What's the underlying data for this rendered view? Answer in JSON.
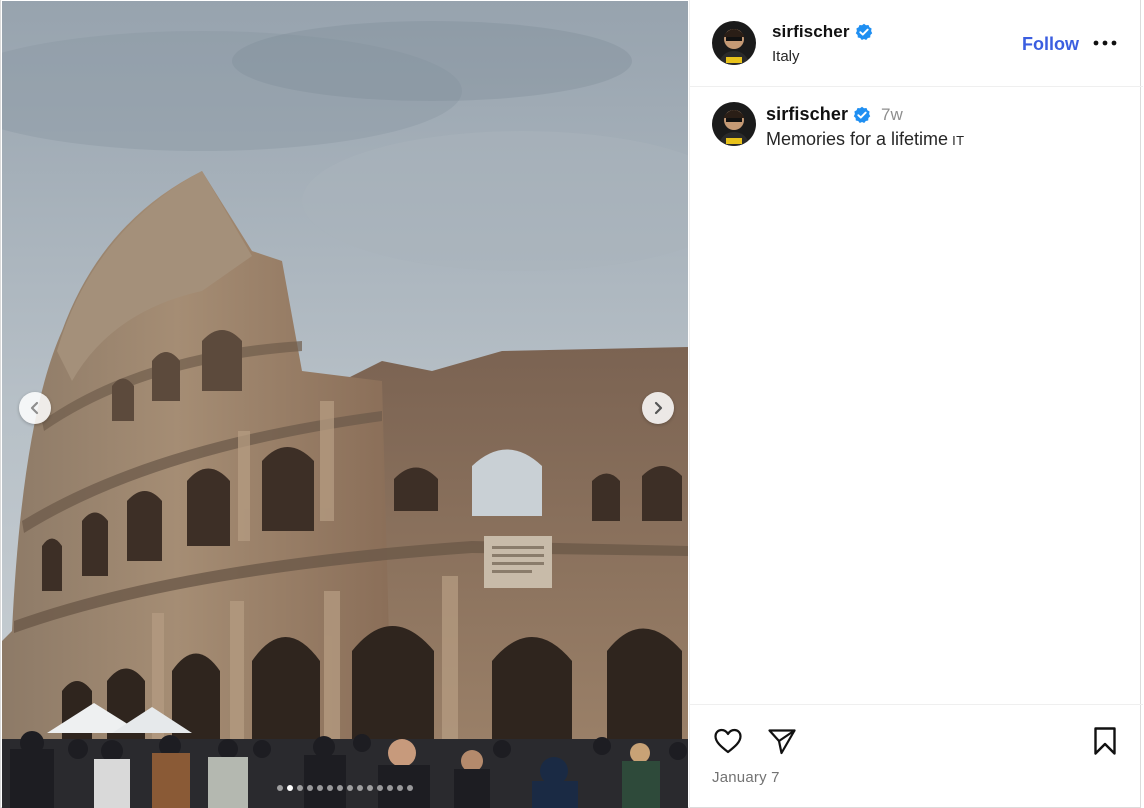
{
  "post": {
    "author": {
      "username": "sirfischer",
      "verified": true,
      "location": "Italy",
      "avatar": "avatar-photo"
    },
    "follow_label": "Follow",
    "more_icon": "more-horizontal-icon",
    "caption": {
      "username": "sirfischer",
      "age": "7w",
      "text": "Memories for a lifetime",
      "flag_text": "IT"
    },
    "media": {
      "description_icon": "photo",
      "carousel_total": 14,
      "carousel_current": 2,
      "prev_icon": "chevron-left-icon",
      "next_icon": "chevron-right-icon"
    },
    "actions": {
      "like_icon": "heart-icon",
      "share_icon": "send-icon",
      "save_icon": "bookmark-icon"
    },
    "date": "January 7"
  },
  "colors": {
    "link_blue": "#3b5ee0",
    "verified_blue": "#1f8ff2",
    "muted": "#8e8e8e"
  }
}
